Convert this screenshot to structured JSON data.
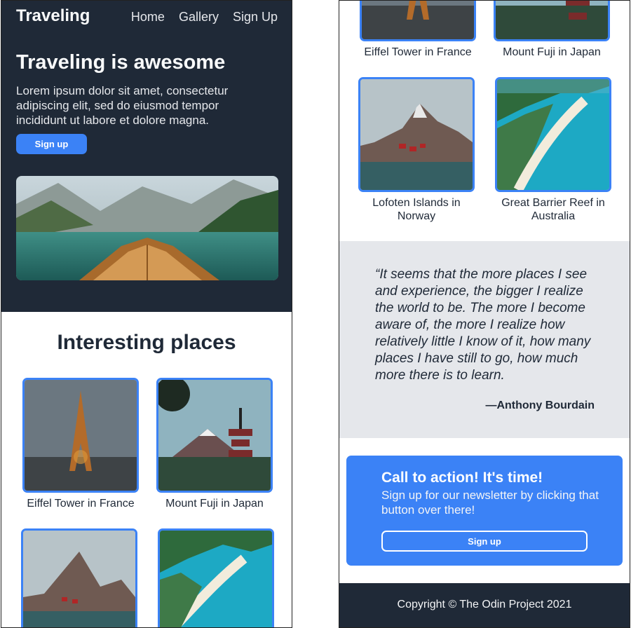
{
  "header": {
    "brand": "Traveling",
    "nav": [
      "Home",
      "Gallery",
      "Sign Up"
    ]
  },
  "hero": {
    "title": "Traveling is awesome",
    "text": "Lorem ipsum dolor sit amet, consectetur adipiscing elit, sed do eiusmod tempor incididunt ut labore et dolore magna.",
    "button": "Sign up",
    "image": "lake-boat-image"
  },
  "places": {
    "title": "Interesting places",
    "items": [
      {
        "caption": "Eiffel Tower in France",
        "image": "eiffel-tower-image"
      },
      {
        "caption": "Mount Fuji in Japan",
        "image": "mount-fuji-image"
      },
      {
        "caption": "Lofoten Islands in Norway",
        "image": "lofoten-image"
      },
      {
        "caption": "Great Barrier Reef in Australia",
        "image": "reef-image"
      }
    ]
  },
  "quote": {
    "text": "“It seems that the more places I see and experience, the bigger I realize the world to be. The more I become aware of, the more I realize how relatively little I know of it, how many places I have still to go, how much more there is to learn.",
    "author": "—Anthony Bourdain"
  },
  "cta": {
    "title": "Call to action! It's time!",
    "text": "Sign up for our newsletter by clicking that button over there!",
    "button": "Sign up"
  },
  "footer": {
    "text": "Copyright © The Odin Project 2021"
  },
  "colors": {
    "dark": "#1f2937",
    "accent": "#3b82f6",
    "quote_bg": "#e5e7eb"
  }
}
